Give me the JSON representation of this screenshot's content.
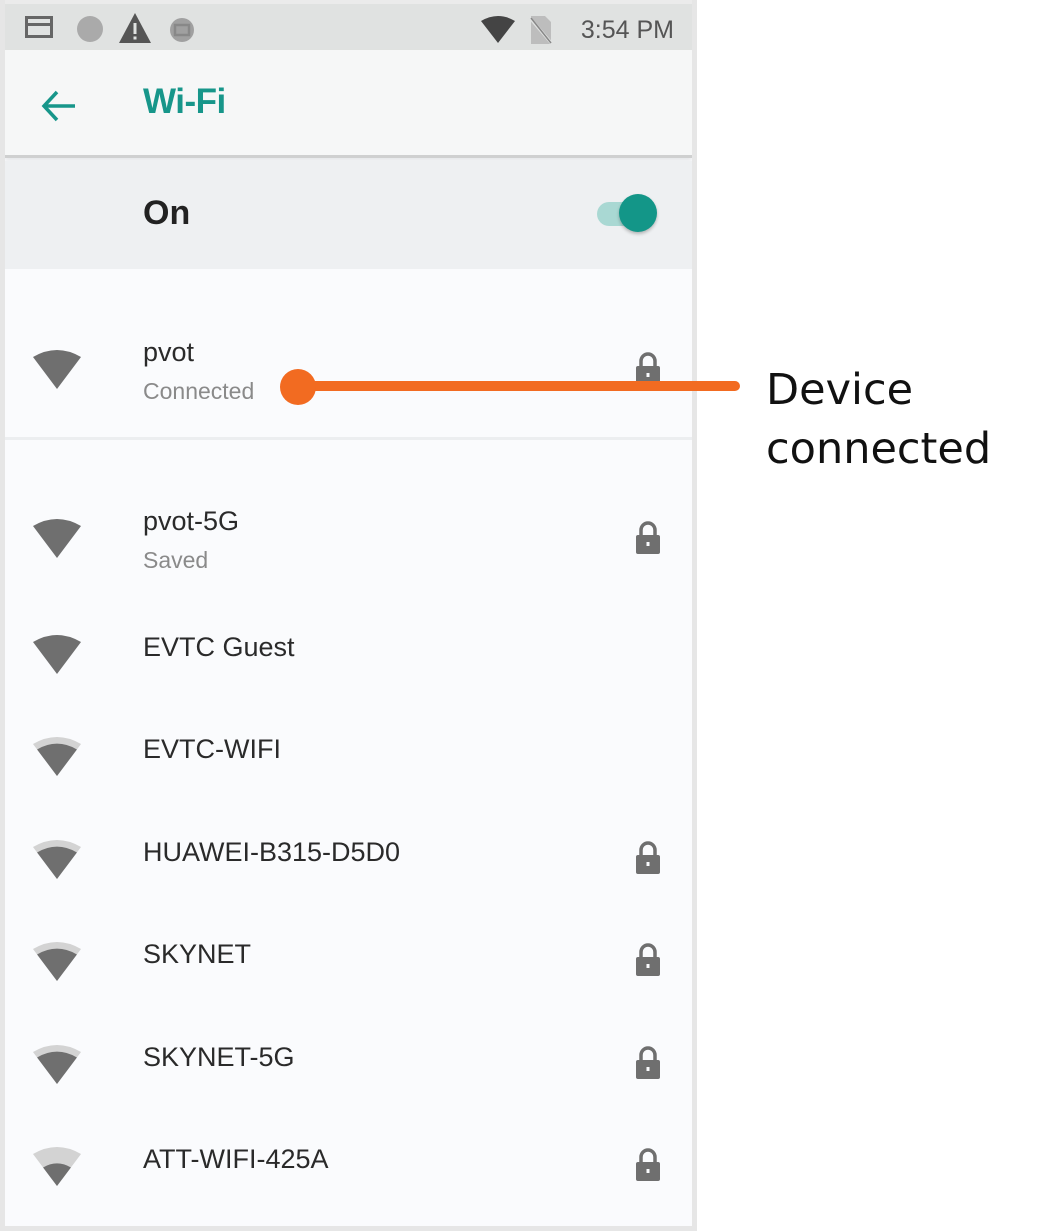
{
  "status_bar": {
    "left_icons": [
      "storage-card-icon",
      "circle-notification-icon",
      "warning-icon",
      "app-notification-icon"
    ],
    "right_icons": [
      "wifi-signal-icon",
      "no-sim-icon"
    ],
    "time": "3:54 PM"
  },
  "app_bar": {
    "back_icon": "arrow-left-icon",
    "title": "Wi-Fi"
  },
  "wifi_switch": {
    "label": "On",
    "checked": true
  },
  "colors": {
    "accent": "#139688",
    "title": "#17968a",
    "toggle_track": "#a9d8d3",
    "callout": "#f26b21",
    "icon_gray": "#6f6f6f"
  },
  "connected_network": {
    "ssid": "pvot",
    "summary": "Connected",
    "signal_level": 4,
    "signal_max": 4,
    "secured": true
  },
  "networks": [
    {
      "ssid": "pvot-5G",
      "summary": "Saved",
      "signal_level": 4,
      "secured": true
    },
    {
      "ssid": "EVTC Guest",
      "summary": "",
      "signal_level": 4,
      "secured": false
    },
    {
      "ssid": "EVTC-WIFI",
      "summary": "",
      "signal_level": 3,
      "secured": false
    },
    {
      "ssid": "HUAWEI-B315-D5D0",
      "summary": "",
      "signal_level": 3,
      "secured": true
    },
    {
      "ssid": "SKYNET",
      "summary": "",
      "signal_level": 3,
      "secured": true
    },
    {
      "ssid": "SKYNET-5G",
      "summary": "",
      "signal_level": 3,
      "secured": true
    },
    {
      "ssid": "ATT-WIFI-425A",
      "summary": "",
      "signal_level": 2,
      "secured": true
    }
  ],
  "annotation": {
    "line1": "Device",
    "line2": "connected"
  }
}
